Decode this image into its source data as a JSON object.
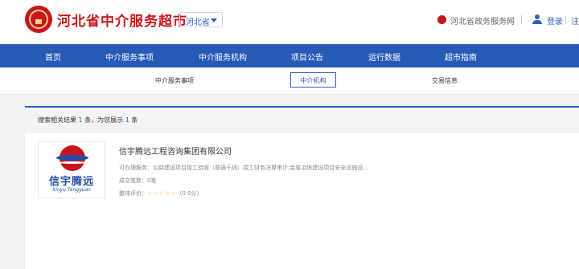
{
  "header": {
    "site_title": "河北省中介服务超市",
    "province_select": "河北省",
    "gov_link": "河北省政务服务网",
    "login": "登录",
    "register": "注"
  },
  "nav": {
    "items": [
      "首页",
      "中介服务事项",
      "中介服务机构",
      "项目公告",
      "运行数据",
      "超市指南"
    ]
  },
  "subnav": {
    "items": [
      "中介服务事项",
      "中介机构",
      "交易信息"
    ],
    "active": "中介机构"
  },
  "results": {
    "prefix": "搜索相关结果",
    "count": "1",
    "middle": "条，为您展示",
    "shown": "1",
    "suffix": "条"
  },
  "company": {
    "logo_cn": "信宇腾远",
    "logo_en": "Xinyu Tengyuan",
    "name": "信宇腾远工程咨询集团有限公司",
    "service_label": "可办理服务：",
    "services": "公路建设项目竣工验收（普通干线）竣工财务决算审计,金属冶炼建设项目安全设施设…",
    "deals_label": "成交笔数：",
    "deals": "0笔",
    "rating_label": "整体评价：",
    "stars": "☆☆☆☆☆",
    "rating_score": "（0.0分）"
  },
  "colors": {
    "brand_red": "#c8161d",
    "nav_blue": "#2759b7",
    "accent_blue": "#2d62c2",
    "star": "#f0a020"
  }
}
